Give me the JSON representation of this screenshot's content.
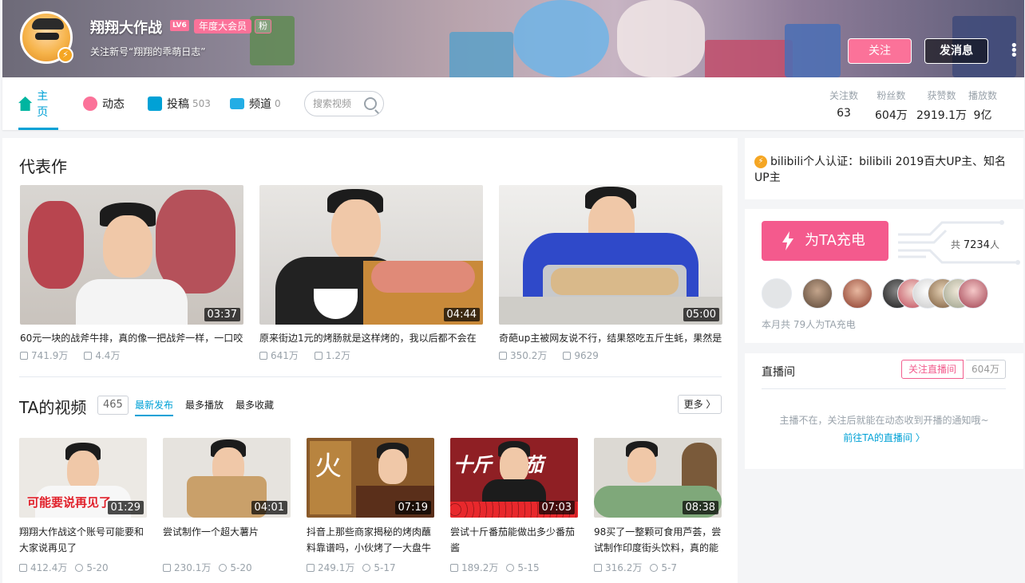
{
  "header": {
    "username": "翔翔大作战",
    "level": "LV6",
    "vip_badge": "年度大会员",
    "fan_badge": "粉",
    "signature": "关注新号“翔翔的乖萌日志”",
    "follow_button": "关注",
    "message_button": "发消息",
    "more_icon": "⋮"
  },
  "nav": {
    "tabs": [
      {
        "label": "主页",
        "count": ""
      },
      {
        "label": "动态",
        "count": ""
      },
      {
        "label": "投稿",
        "count": "503"
      },
      {
        "label": "频道",
        "count": "0"
      }
    ],
    "search_placeholder": "搜索视频",
    "stats": [
      {
        "label": "关注数",
        "value": "63"
      },
      {
        "label": "粉丝数",
        "value": "604万"
      },
      {
        "label": "获赞数",
        "value": "2919.1万"
      },
      {
        "label": "播放数",
        "value": "9亿"
      }
    ]
  },
  "masterpiece": {
    "title": "代表作",
    "videos": [
      {
        "title": "60元一块的战斧牛排，真的像一把战斧一样，一口咬",
        "duration": "03:37",
        "plays": "741.9万",
        "danmaku": "4.4万"
      },
      {
        "title": "原来街边1元的烤肠就是这样烤的，我以后都不会在",
        "duration": "04:44",
        "plays": "641万",
        "danmaku": "1.2万"
      },
      {
        "title": "奇葩up主被网友说不行，结果怒吃五斤生蚝，果然是",
        "duration": "05:00",
        "plays": "350.2万",
        "danmaku": "9629"
      }
    ]
  },
  "videos": {
    "title": "TA的视频",
    "count": "465",
    "sort_options": [
      "最新发布",
      "最多播放",
      "最多收藏"
    ],
    "more_label": "更多 〉",
    "items": [
      {
        "title": "翔翔大作战这个账号可能要和大家说再见了",
        "duration": "01:29",
        "plays": "412.4万",
        "date": "5-20",
        "overlay": "可能要说再见了"
      },
      {
        "title": "尝试制作一个超大薯片",
        "duration": "04:01",
        "plays": "230.1万",
        "date": "5-20",
        "overlay": ""
      },
      {
        "title": "抖音上那些商家揭秘的烤肉蘸料靠谱吗，小伙烤了一大盘牛",
        "duration": "07:19",
        "plays": "249.1万",
        "date": "5-17",
        "overlay": "火"
      },
      {
        "title": "尝试十斤番茄能做出多少番茄酱",
        "duration": "07:03",
        "plays": "189.2万",
        "date": "5-15",
        "overlay": "十斤  番茄"
      },
      {
        "title": "98买了一整颗可食用芦荟，尝试制作印度街头饮料，真的能",
        "duration": "08:38",
        "plays": "316.2万",
        "date": "5-7",
        "overlay": ""
      }
    ]
  },
  "sidebar": {
    "certification": "bilibili个人认证：bilibili 2019百大UP主、知名UP主",
    "charge_button": "为TA充电",
    "charge_total_prefix": "共",
    "charge_total": "7234",
    "charge_total_suffix": "人",
    "charge_note": "本月共 79人为TA充电",
    "live_title": "直播间",
    "live_follow": "关注直播间",
    "live_count": "604万",
    "live_message": "主播不在，关注后就能在动态收到开播的通知哦~",
    "live_link": "前往TA的直播间  〉"
  }
}
